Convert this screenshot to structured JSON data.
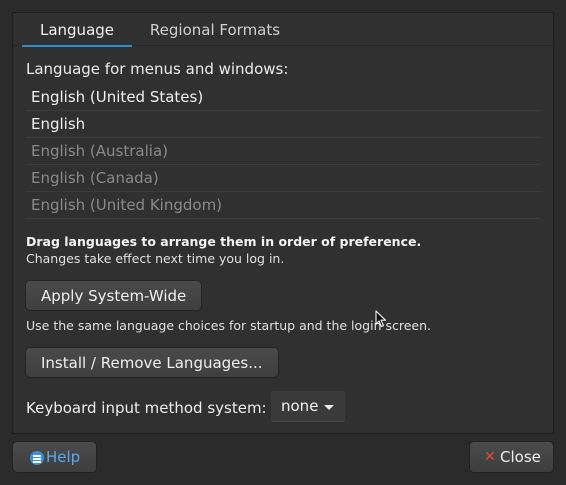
{
  "tabs": [
    {
      "label": "Language",
      "active": true
    },
    {
      "label": "Regional Formats",
      "active": false
    }
  ],
  "language_section": {
    "heading": "Language for menus and windows:",
    "languages": [
      {
        "label": "English (United States)",
        "enabled": true
      },
      {
        "label": "English",
        "enabled": true
      },
      {
        "label": "English (Australia)",
        "enabled": false
      },
      {
        "label": "English (Canada)",
        "enabled": false
      },
      {
        "label": "English (United Kingdom)",
        "enabled": false
      }
    ],
    "hint_bold": "Drag languages to arrange them in order of preference.",
    "hint": "Changes take effect next time you log in."
  },
  "apply_button": "Apply System-Wide",
  "apply_note": "Use the same language choices for startup and the login screen.",
  "install_button": "Install / Remove Languages...",
  "keyboard": {
    "label": "Keyboard input method system:",
    "value": "none"
  },
  "footer": {
    "help_label": "Help",
    "close_label": "Close"
  },
  "colors": {
    "accent": "#2a8bd6",
    "help_text": "#5aa9ea",
    "close_icon": "#e04a3a"
  },
  "icons": [
    "help-icon",
    "close-icon",
    "dropdown-caret-icon",
    "mouse-pointer-icon"
  ]
}
